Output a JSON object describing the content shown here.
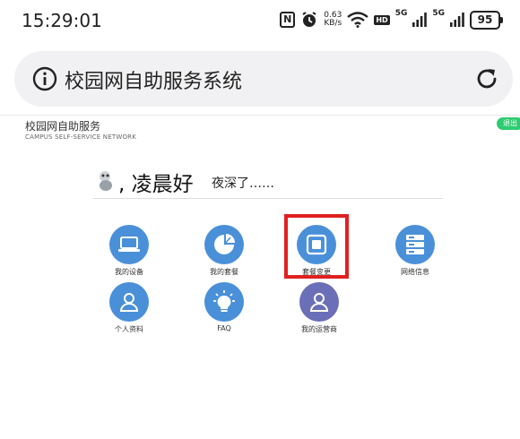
{
  "status_bar": {
    "time": "15:29:01",
    "nfc_badge": "N",
    "speed_value": "0.63",
    "speed_unit": "KB/s",
    "hd_label": "HD",
    "net_label_1": "5G",
    "net_label_2": "5G",
    "battery": "95"
  },
  "browser": {
    "title": "校园网自助服务系统"
  },
  "site": {
    "title": "校园网自助服务",
    "subtitle": "CAMPUS SELF-SERVICE NETWORK",
    "logout_label": "退出"
  },
  "greeting": {
    "text": ", 凌晨好",
    "sub": "夜深了……"
  },
  "tiles": [
    {
      "label": "我的设备",
      "icon": "laptop-icon"
    },
    {
      "label": "我的套餐",
      "icon": "pie-chart-icon"
    },
    {
      "label": "套餐变更",
      "icon": "square-stack-icon"
    },
    {
      "label": "网络信息",
      "icon": "server-icon"
    },
    {
      "label": "个人资料",
      "icon": "user-icon"
    },
    {
      "label": "FAQ",
      "icon": "lightbulb-icon"
    },
    {
      "label": "我的运营商",
      "icon": "user-icon"
    }
  ],
  "colors": {
    "tile_blue": "#4a90d9",
    "tile_purple": "#6b6fb8",
    "logout_green": "#2ecc71",
    "highlight_red": "#e02020"
  }
}
